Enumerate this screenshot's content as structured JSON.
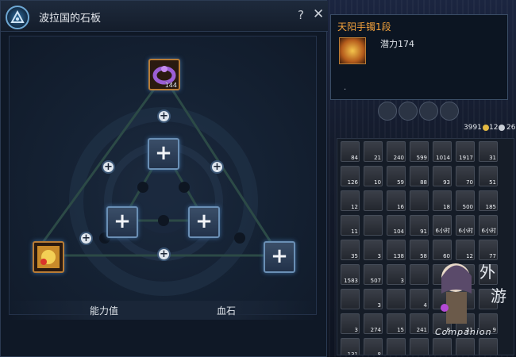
{
  "dialog": {
    "title": "波拉国的石板",
    "help_label": "?",
    "close_label": "✕",
    "tabs": [
      "能力值",
      "血石"
    ],
    "equipped": {
      "name": "天阳手镯1段",
      "count": "144"
    }
  },
  "tooltip": {
    "title": "天阳手镯1段",
    "stat": "潜力174",
    "footer": "."
  },
  "currency": {
    "gold": "3991",
    "silver": "12",
    "copper": "26"
  },
  "inventory": {
    "counts": [
      "84",
      "21",
      "240",
      "599",
      "1014",
      "1917",
      "31",
      "126",
      "10",
      "59",
      "88",
      "93",
      "70",
      "51",
      "12",
      "",
      "16",
      "",
      "18",
      "500",
      "185",
      "11",
      "",
      "104",
      "91",
      "6小时",
      "6小时",
      "6小时",
      "35",
      "3",
      "138",
      "58",
      "60",
      "12",
      "77",
      "1583",
      "507",
      "3",
      "",
      "",
      "",
      "",
      "",
      "3",
      "",
      "4",
      "",
      "",
      "",
      "3",
      "274",
      "15",
      "241",
      "8",
      "51",
      "9",
      "131",
      "8",
      "",
      "",
      "",
      "",
      ""
    ]
  },
  "watermark": {
    "text": "Companion"
  },
  "colors": {
    "tooltip_title": "#f4a23c",
    "slot_border": "#6a8fb5",
    "accent_gold": "#e3b842"
  }
}
